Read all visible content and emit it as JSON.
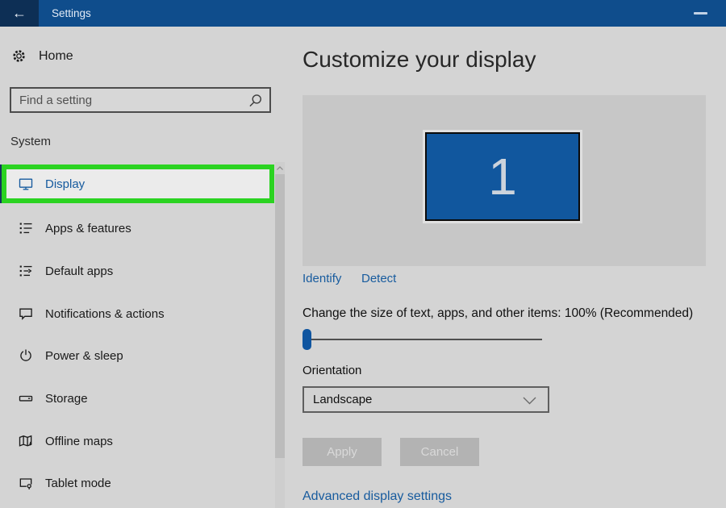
{
  "titlebar": {
    "app_title": "Settings",
    "back_glyph": "←",
    "back_icon": "back-arrow-icon",
    "minimize_icon": "minimize-icon"
  },
  "sidebar": {
    "home_label": "Home",
    "home_icon": "gear-icon",
    "search_placeholder": "Find a setting",
    "search_icon": "search-icon",
    "section_header": "System",
    "items": [
      {
        "label": "Display",
        "icon": "monitor-icon",
        "selected": true
      },
      {
        "label": "Apps & features",
        "icon": "apps-list-icon",
        "selected": false
      },
      {
        "label": "Default apps",
        "icon": "default-apps-icon",
        "selected": false
      },
      {
        "label": "Notifications & actions",
        "icon": "speech-bubble-icon",
        "selected": false
      },
      {
        "label": "Power & sleep",
        "icon": "power-icon",
        "selected": false
      },
      {
        "label": "Storage",
        "icon": "drive-icon",
        "selected": false
      },
      {
        "label": "Offline maps",
        "icon": "map-icon",
        "selected": false
      },
      {
        "label": "Tablet mode",
        "icon": "tablet-icon",
        "selected": false
      }
    ]
  },
  "main": {
    "heading": "Customize your display",
    "monitor_number": "1",
    "identify_link": "Identify",
    "detect_link": "Detect",
    "scale_label": "Change the size of text, apps, and other items: 100% (Recommended)",
    "scale_slider": {
      "value_percent": 0,
      "thumb_position": "far-left"
    },
    "orientation_label": "Orientation",
    "orientation_value": "Landscape",
    "apply_label": "Apply",
    "cancel_label": "Cancel",
    "buttons_state": "disabled",
    "advanced_link": "Advanced display settings"
  },
  "annotation": {
    "type": "highlight-box",
    "target": "Display sidebar item",
    "color": "#2bd321"
  },
  "colors": {
    "titlebar_blue": "#0f4d8c",
    "back_button_navy": "#0d2f55",
    "app_background": "#d4d4d4",
    "preview_background": "#c7c7c7",
    "monitor_blue": "#11579e",
    "selected_row": "#ebebeb",
    "link_blue": "#175b9e",
    "highlight_green": "#2bd321",
    "disabled_button": "#b3b3b3"
  }
}
